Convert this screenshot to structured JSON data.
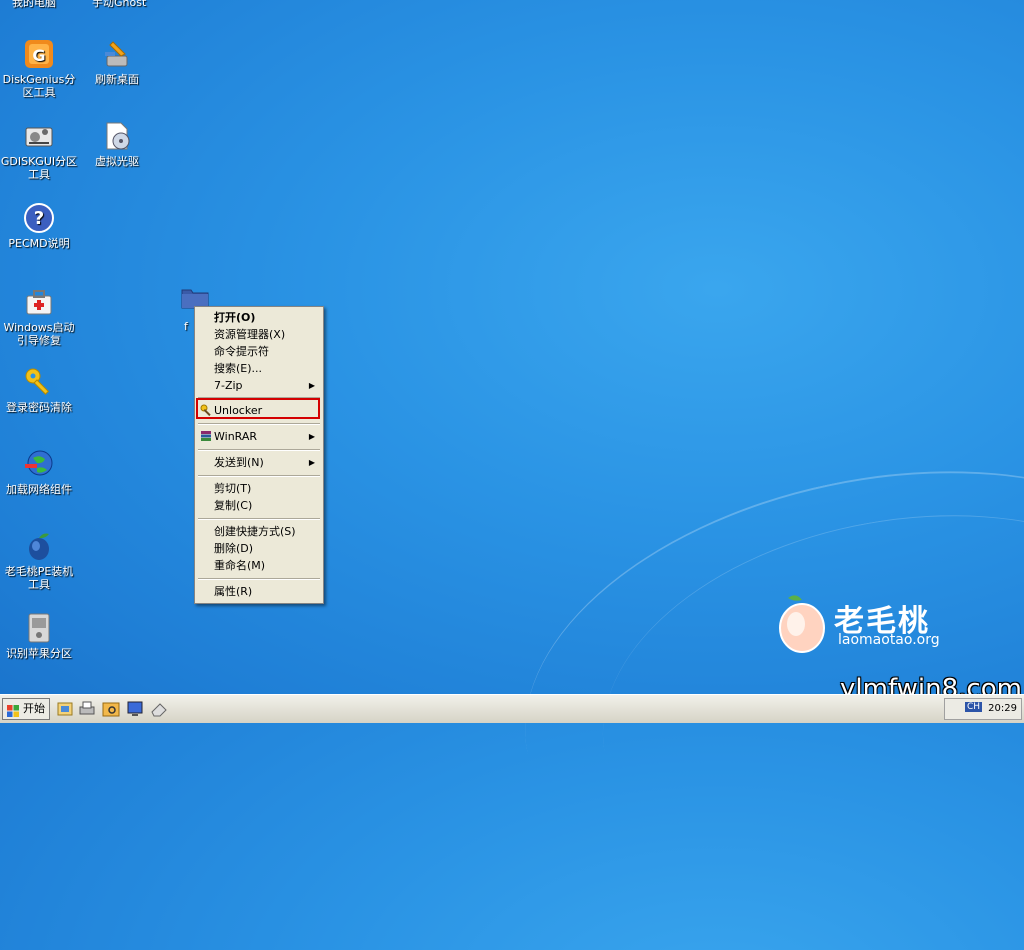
{
  "desktop": {
    "top_partial": [
      "我的电脑",
      "手动Ghost"
    ],
    "icons": [
      {
        "label": "DiskGenius分区工具",
        "icon": "diskgenius-icon"
      },
      {
        "label": "刷新桌面",
        "icon": "refresh-desktop-icon"
      },
      {
        "label": "GDISKGUI分区工具",
        "icon": "gdiskgui-icon"
      },
      {
        "label": "虚拟光驱",
        "icon": "virtual-drive-icon"
      },
      {
        "label": "PECMD说明",
        "icon": "help-icon"
      },
      {
        "label": "Windows启动引导修复",
        "icon": "boot-repair-icon"
      },
      {
        "label": "登录密码清除",
        "icon": "key-icon"
      },
      {
        "label": "加载网络组件",
        "icon": "network-globe-icon"
      },
      {
        "label": "老毛桃PE装机工具",
        "icon": "peach-installer-icon"
      },
      {
        "label": "识别苹果分区",
        "icon": "apple-partition-icon"
      }
    ],
    "selected_folder_label": "f"
  },
  "context_menu": {
    "items": [
      {
        "label": "打开(O)",
        "bold": true
      },
      {
        "label": "资源管理器(X)"
      },
      {
        "label": "命令提示符"
      },
      {
        "label": "搜索(E)..."
      },
      {
        "label": "7-Zip",
        "submenu": true
      },
      {
        "label": "Unlocker",
        "highlighted": true
      },
      {
        "label": "WinRAR",
        "submenu": true
      },
      {
        "label": "发送到(N)",
        "submenu": true
      },
      {
        "label": "剪切(T)"
      },
      {
        "label": "复制(C)"
      },
      {
        "label": "创建快捷方式(S)"
      },
      {
        "label": "删除(D)"
      },
      {
        "label": "重命名(M)"
      },
      {
        "label": "属性(R)"
      }
    ],
    "highlight_color": "#d40000"
  },
  "taskbar": {
    "start_label": "开始",
    "ime": "CH",
    "clock": "20:29"
  },
  "brand": {
    "name_cn": "老毛桃",
    "url": "laomaotao.org"
  },
  "watermark": "ylmfwin8.com"
}
